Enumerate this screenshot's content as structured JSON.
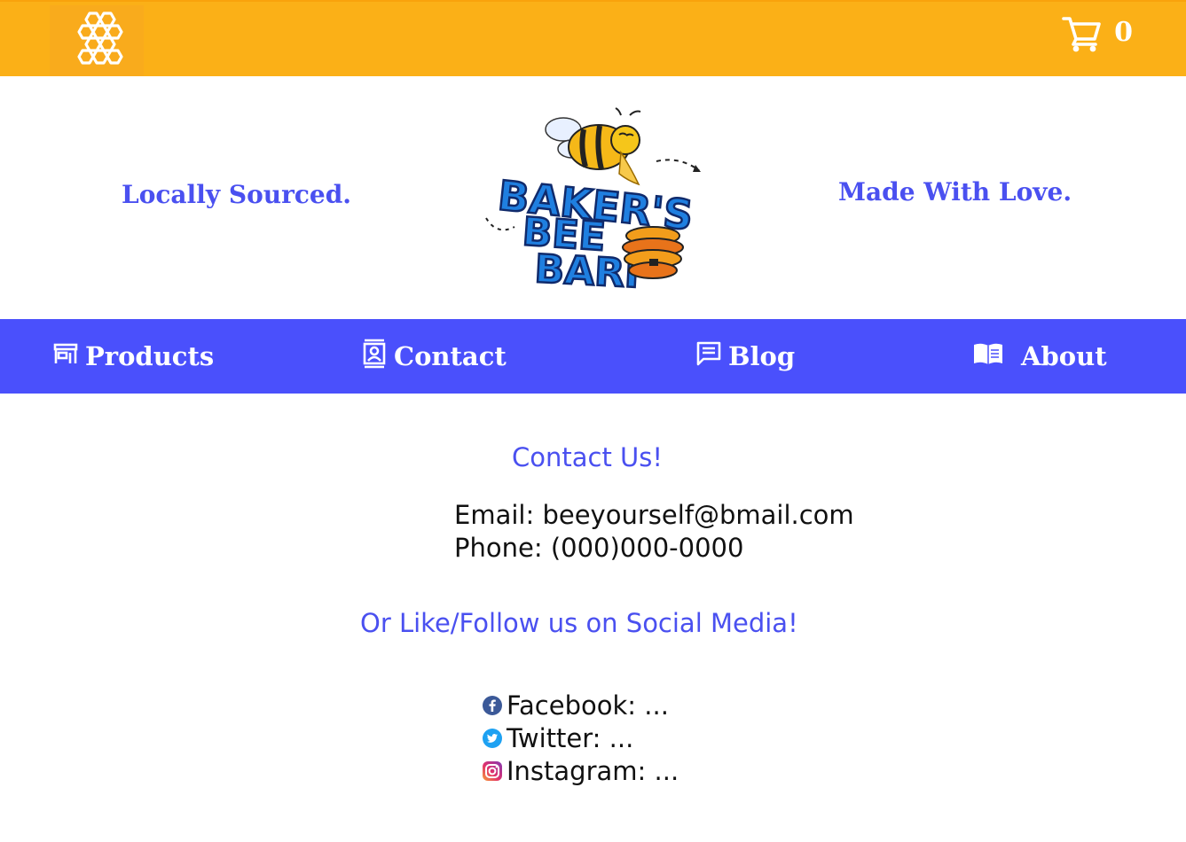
{
  "header": {
    "logo_icon": "honeycomb-icon",
    "cart_icon": "cart-icon",
    "cart_count": "0",
    "colors": {
      "bar": "#fbb017",
      "logo_bg": "#f9ab1c"
    }
  },
  "hero": {
    "slogan_left": "Locally Sourced.",
    "slogan_right": "Made With Love.",
    "brand_logo_text": "BAKER'S BEE BARF"
  },
  "nav": {
    "background": "#4a50fc",
    "items": [
      {
        "label": "Products",
        "icon": "storefront-icon"
      },
      {
        "label": "Contact",
        "icon": "contact-card-icon"
      },
      {
        "label": "Blog",
        "icon": "message-icon"
      },
      {
        "label": "About",
        "icon": "book-icon"
      }
    ]
  },
  "main": {
    "contact_heading": "Contact Us!",
    "email": "Email: beeyourself@bmail.com",
    "phone": "Phone: (000)000-0000",
    "social_heading": "Or Like/Follow us on Social Media!",
    "social": [
      {
        "label": "Facebook: ...",
        "icon": "facebook-icon"
      },
      {
        "label": "Twitter: ...",
        "icon": "twitter-icon"
      },
      {
        "label": "Instagram: ...",
        "icon": "instagram-icon"
      }
    ],
    "accent_color": "#4a50f0"
  }
}
